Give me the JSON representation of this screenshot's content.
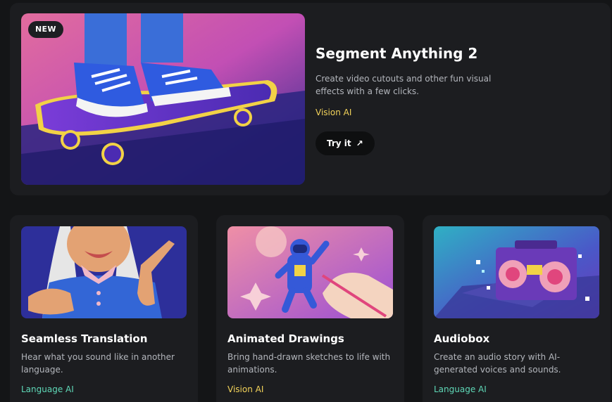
{
  "featured": {
    "badge": "NEW",
    "title": "Segment Anything 2",
    "description": "Create video cutouts and other fun visual effects with a few clicks.",
    "tag": "Vision AI",
    "cta_label": "Try it",
    "cta_icon": "arrow-up-right-icon"
  },
  "cards": [
    {
      "title": "Seamless Translation",
      "description": "Hear what you sound like in another language.",
      "tag": "Language AI",
      "tag_color": "#5fd8b7"
    },
    {
      "title": "Animated Drawings",
      "description": "Bring hand-drawn sketches to life with animations.",
      "tag": "Vision AI",
      "tag_color": "#f3d35a"
    },
    {
      "title": "Audiobox",
      "description": "Create an audio story with AI-generated voices and sounds.",
      "tag": "Language AI",
      "tag_color": "#5fd8b7"
    }
  ],
  "colors": {
    "background": "#141517",
    "card": "#1c1d20",
    "vision_tag": "#f3d35a",
    "language_tag": "#5fd8b7"
  }
}
